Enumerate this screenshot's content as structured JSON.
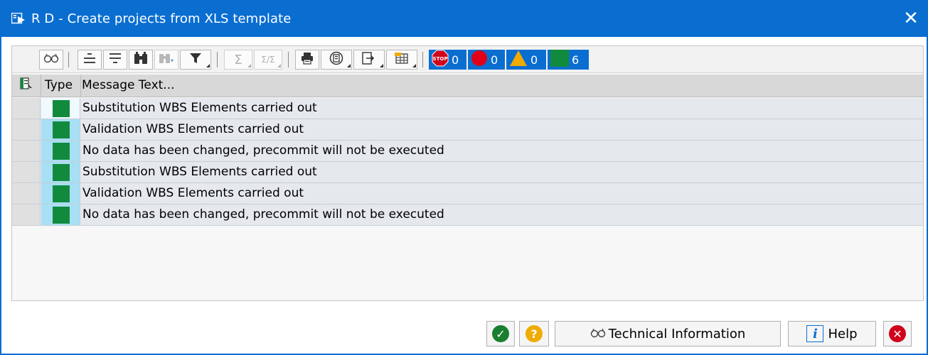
{
  "window": {
    "title": "R D - Create projects from XLS template",
    "close_glyph": "✕"
  },
  "toolbar": {
    "counters": [
      {
        "name": "stop",
        "icon": "stop-icon",
        "count": "0",
        "color": "#d0021b"
      },
      {
        "name": "error",
        "icon": "red-circle-icon",
        "count": "0",
        "color": "#e0001a"
      },
      {
        "name": "warning",
        "icon": "warning-triangle-icon",
        "count": "0",
        "color": "#f0ab00"
      },
      {
        "name": "success",
        "icon": "green-square-icon",
        "count": "6",
        "color": "#118a3e"
      }
    ],
    "stop_icon_text": "STOP",
    "sum_glyph": "Σ",
    "subtotal_glyph": "Σ/Σ"
  },
  "grid": {
    "columns": {
      "type": "Type",
      "message": "Message Text..."
    },
    "rows": [
      {
        "type_icon": "green-square-icon",
        "message": "Substitution WBS Elements carried out"
      },
      {
        "type_icon": "green-square-icon",
        "message": "Validation WBS Elements carried out"
      },
      {
        "type_icon": "green-square-icon",
        "message": "No data has been changed, precommit will not be executed"
      },
      {
        "type_icon": "green-square-icon",
        "message": "Substitution WBS Elements carried out"
      },
      {
        "type_icon": "green-square-icon",
        "message": "Validation WBS Elements carried out"
      },
      {
        "type_icon": "green-square-icon",
        "message": "No data has been changed, precommit will not be executed"
      }
    ]
  },
  "footer": {
    "technical_info_label": "Technical Information",
    "help_label": "Help",
    "help_icon_glyph": "i",
    "confirm_glyph": "✓",
    "question_glyph": "?",
    "cancel_glyph": "✕"
  },
  "colors": {
    "accent": "#0a6ed1",
    "success": "#118a3e",
    "help_circle": "#f0ab00",
    "cancel_circle": "#d0021b"
  }
}
